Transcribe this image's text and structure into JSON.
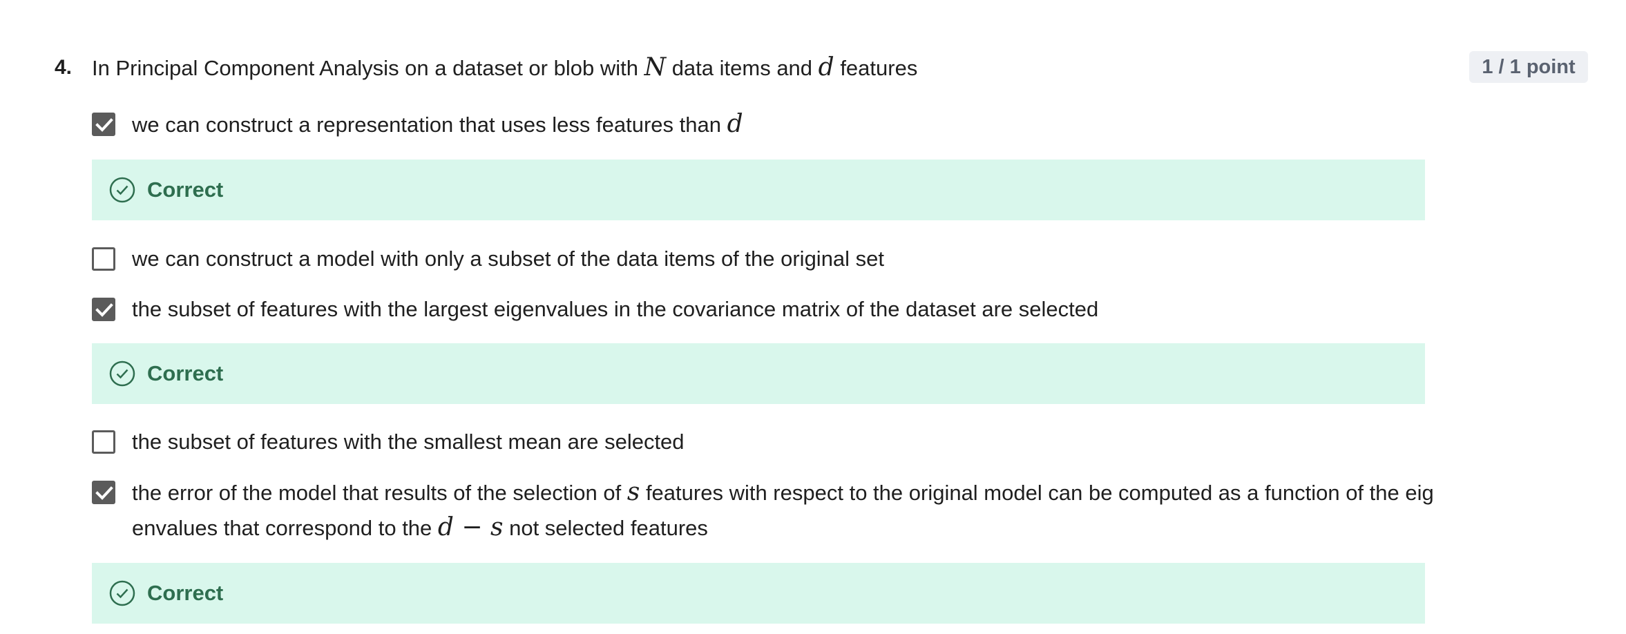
{
  "question": {
    "number": "4.",
    "text_parts": [
      "In Principal Component Analysis on a dataset or blob with ",
      "N",
      " data items and ",
      "d",
      " features"
    ],
    "points": "1 / 1 point"
  },
  "options": [
    {
      "checked": true,
      "text_parts": [
        "we can construct a representation that uses less features than ",
        "d"
      ],
      "feedback": "Correct"
    },
    {
      "checked": false,
      "text_parts": [
        "we can construct a model with only a subset of the data items of the original set"
      ],
      "feedback": ""
    },
    {
      "checked": true,
      "text_parts": [
        "the subset of features with the largest eigenvalues in the covariance matrix of the dataset are selected"
      ],
      "feedback": "Correct"
    },
    {
      "checked": false,
      "text_parts": [
        "the subset of features with the smallest mean are selected"
      ],
      "feedback": ""
    },
    {
      "checked": true,
      "text_parts": [
        "the error of the model that results of the selection of ",
        "s",
        " features with respect to the original model can be computed as a function of the eig envalues that correspond to the ",
        "d − s",
        " not selected features"
      ],
      "feedback": "Correct"
    }
  ],
  "colors": {
    "feedback_bg": "#d9f7ec",
    "feedback_text": "#2e6e4f",
    "checkbox": "#5b5b5b",
    "badge_bg": "#eef0f4",
    "badge_text": "#5a6270"
  },
  "icons": {
    "check": "checkmark-icon",
    "feedback": "check-circle-icon"
  }
}
